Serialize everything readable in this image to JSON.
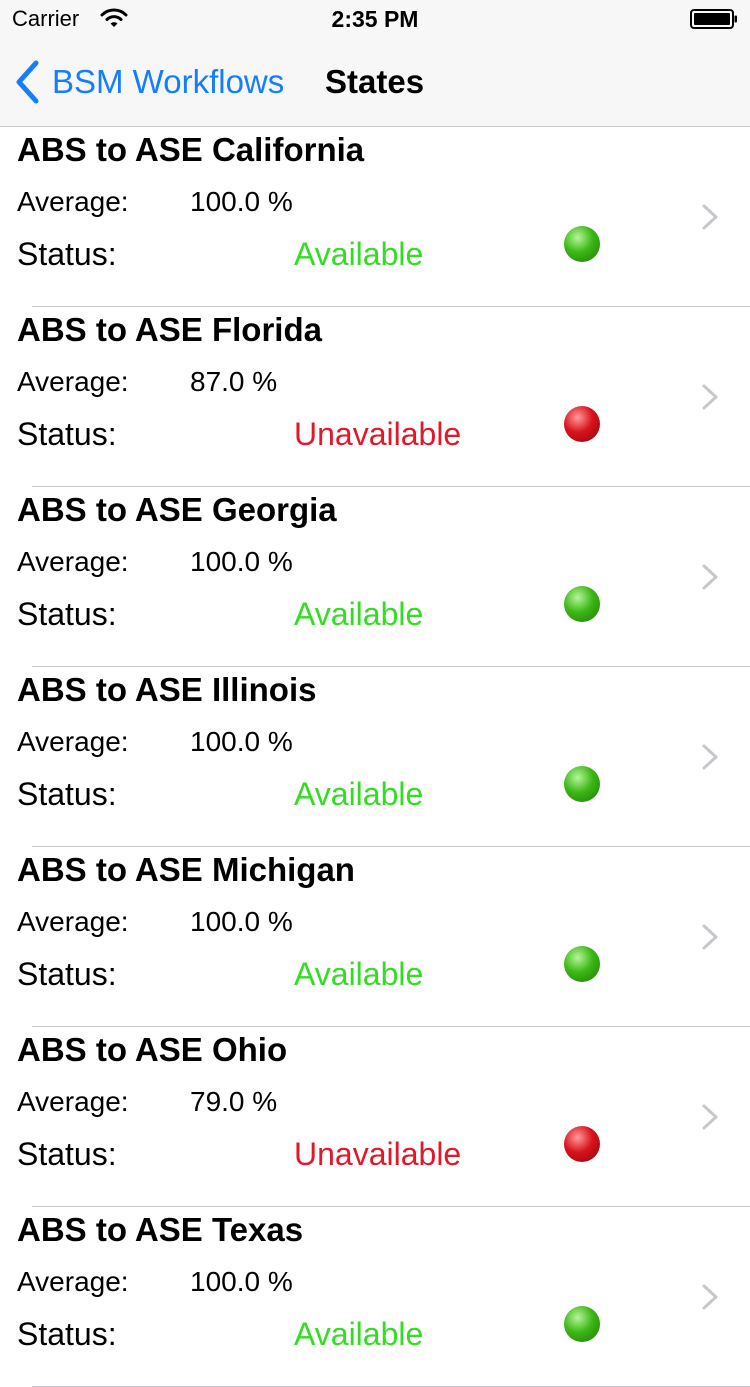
{
  "status_bar": {
    "carrier": "Carrier",
    "time": "2:35 PM",
    "icons": [
      "wifi-icon",
      "battery-icon"
    ]
  },
  "nav": {
    "back_label": "BSM Workflows",
    "title": "States",
    "back_icon": "chevron-left-icon",
    "accent_color": "#147efb"
  },
  "labels": {
    "average": "Average:",
    "status": "Status:"
  },
  "colors": {
    "available": "#33dd22",
    "unavailable": "#e3172a",
    "available_dot": "#3cb816",
    "unavailable_dot": "#d9121c"
  },
  "rows": [
    {
      "title": "ABS to ASE California",
      "average": "100.0 %",
      "status": "Available",
      "available": true
    },
    {
      "title": "ABS to ASE Florida",
      "average": "87.0 %",
      "status": "Unavailable",
      "available": false
    },
    {
      "title": "ABS to ASE Georgia",
      "average": "100.0 %",
      "status": "Available",
      "available": true
    },
    {
      "title": "ABS to ASE Illinois",
      "average": "100.0 %",
      "status": "Available",
      "available": true
    },
    {
      "title": "ABS to ASE Michigan",
      "average": "100.0 %",
      "status": "Available",
      "available": true
    },
    {
      "title": "ABS to ASE Ohio",
      "average": "79.0 %",
      "status": "Unavailable",
      "available": false
    },
    {
      "title": "ABS to ASE Texas",
      "average": "100.0 %",
      "status": "Available",
      "available": true
    }
  ]
}
